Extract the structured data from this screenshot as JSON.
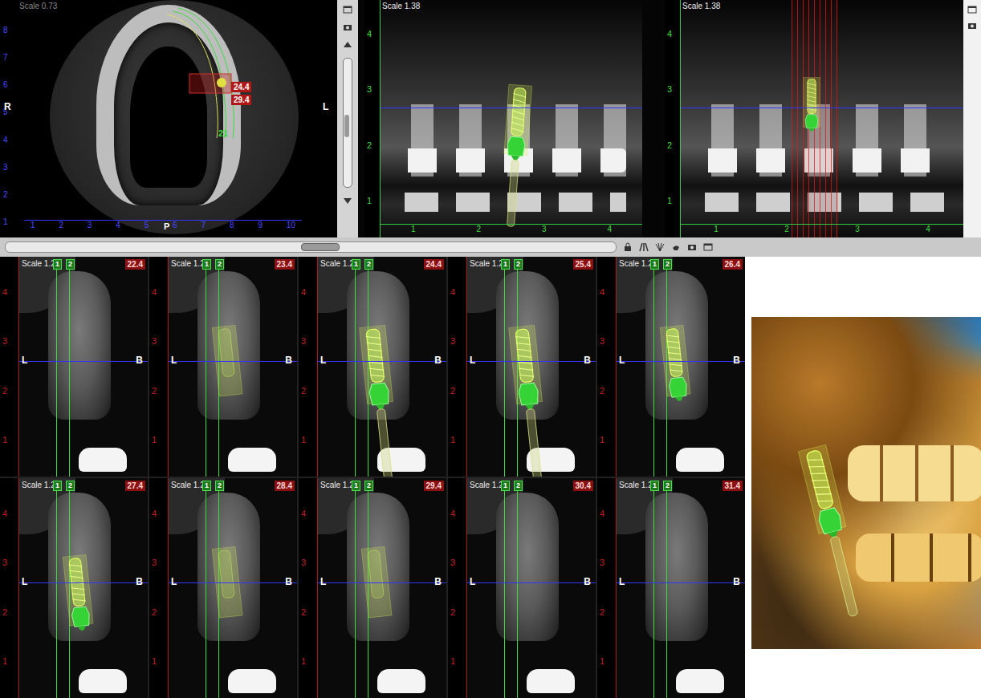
{
  "axial": {
    "scale": "Scale 0.73",
    "side_left": "R",
    "side_right": "L",
    "y_ticks": [
      "8",
      "7",
      "6",
      "5",
      "4",
      "3",
      "2",
      "1"
    ],
    "x_ticks": [
      "1",
      "2",
      "3",
      "4",
      "5",
      "6",
      "7",
      "8",
      "9",
      "10"
    ],
    "posterior": "P",
    "markers": [
      "24.4",
      "29.4"
    ],
    "curve_label": "21"
  },
  "panoramic": {
    "scale": "Scale 1.38",
    "y_ticks": [
      "4",
      "3",
      "2",
      "1"
    ],
    "x_ticks": [
      "1",
      "2",
      "3",
      "4"
    ]
  },
  "cross_panoramic": {
    "scale": "Scale 1.38",
    "y_ticks": [
      "4",
      "3",
      "2",
      "1"
    ],
    "x_ticks": [
      "1",
      "2",
      "3",
      "4"
    ]
  },
  "sections": [
    {
      "label": "22.4",
      "scale": "Scale 1.25",
      "guides": [
        "1",
        "2"
      ],
      "left": "L",
      "right": "B",
      "ticks": [
        "4",
        "3",
        "2",
        "1"
      ],
      "kind": "none"
    },
    {
      "label": "23.4",
      "scale": "Scale 1.25",
      "guides": [
        "1",
        "2"
      ],
      "left": "L",
      "right": "B",
      "ticks": [
        "4",
        "3",
        "2",
        "1"
      ],
      "kind": "ghost"
    },
    {
      "label": "24.4",
      "scale": "Scale 1.25",
      "guides": [
        "1",
        "2"
      ],
      "left": "L",
      "right": "B",
      "ticks": [
        "4",
        "3",
        "2",
        "1"
      ],
      "kind": "extended"
    },
    {
      "label": "25.4",
      "scale": "Scale 1.25",
      "guides": [
        "1",
        "2"
      ],
      "left": "L",
      "right": "B",
      "ticks": [
        "4",
        "3",
        "2",
        "1"
      ],
      "kind": "extended"
    },
    {
      "label": "26.4",
      "scale": "Scale 1.25",
      "guides": [
        "1",
        "2"
      ],
      "left": "L",
      "right": "B",
      "ticks": [
        "4",
        "3",
        "2",
        "1"
      ],
      "kind": "full"
    },
    {
      "label": "27.4",
      "scale": "Scale 1.25",
      "guides": [
        "1",
        "2"
      ],
      "left": "L",
      "right": "B",
      "ticks": [
        "4",
        "3",
        "2",
        "1"
      ],
      "kind": "full"
    },
    {
      "label": "28.4",
      "scale": "Scale 1.25",
      "guides": [
        "1",
        "2"
      ],
      "left": "L",
      "right": "B",
      "ticks": [
        "4",
        "3",
        "2",
        "1"
      ],
      "kind": "ghost"
    },
    {
      "label": "29.4",
      "scale": "Scale 1.25",
      "guides": [
        "1",
        "2"
      ],
      "left": "L",
      "right": "B",
      "ticks": [
        "4",
        "3",
        "2",
        "1"
      ],
      "kind": "ghost"
    },
    {
      "label": "30.4",
      "scale": "Scale 1.25",
      "guides": [
        "1",
        "2"
      ],
      "left": "L",
      "right": "B",
      "ticks": [
        "4",
        "3",
        "2",
        "1"
      ],
      "kind": "none"
    },
    {
      "label": "31.4",
      "scale": "Scale 1.25",
      "guides": [
        "1",
        "2"
      ],
      "left": "L",
      "right": "B",
      "ticks": [
        "4",
        "3",
        "2",
        "1"
      ],
      "kind": "none"
    }
  ]
}
